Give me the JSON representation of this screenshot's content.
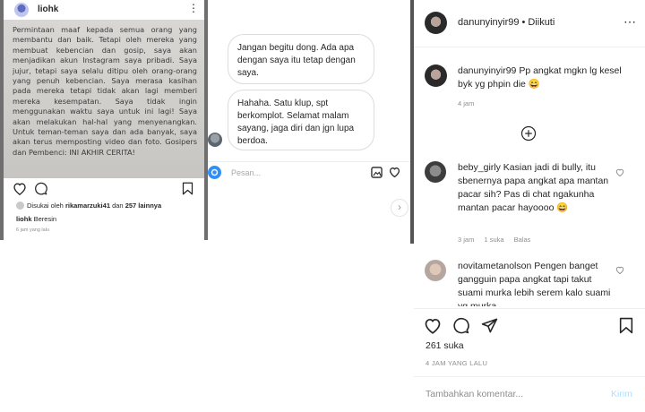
{
  "left_post": {
    "username": "liohk",
    "image_text": "Permintaan maaf kepada semua orang yang membantu dan baik. Tetapi oleh mereka yang membuat kebencian dan gosip, saya akan menjadikan akun Instagram saya pribadi. Saya jujur, tetapi saya selalu ditipu oleh orang-orang yang penuh kebencian. Saya merasa kasihan pada mereka tetapi tidak akan lagi memberi mereka kesempatan. Saya tidak ingin menggunakan waktu saya untuk ini lagi! Saya akan melakukan hal-hal yang menyenangkan. Untuk teman-teman saya dan ada banyak, saya akan terus memposting video dan foto. Gosipers dan Pembenci: INI AKHIR CERITA!",
    "liked_prefix": "Disukai oleh",
    "liked_user": "rikamarzuki41",
    "liked_mid": "dan",
    "liked_others": "257 lainnya",
    "caption_user": "liohk",
    "caption_text": "Beresin",
    "time": "6 jam yang lalu"
  },
  "chat": {
    "bubble_1": "Jangan begitu dong. Ada apa dengan saya itu tetap dengan saya.",
    "bubble_2": "Hahaha. Satu klup, spt berkomplot. Selamat malam sayang, jaga diri dan jgn lupa berdoa.",
    "composer_placeholder": "Pesan..."
  },
  "right_panel": {
    "header_username": "danunyinyir99",
    "header_dot": "•",
    "header_follow": "Diikuti",
    "caption_username": "danunyinyir99",
    "caption_text": "Pp angkat mgkn lg kesel byk yg phpin die 😄",
    "caption_time": "4 jam",
    "comments": [
      {
        "username": "beby_girly",
        "text": "Kasian jadi di bully, itu sbenernya papa angkat apa mantan pacar sih? Pas di chat ngakunha mantan pacar hayoooo 😄",
        "time": "3 jam",
        "likes": "1 suka",
        "reply": "Balas"
      },
      {
        "username": "novitametanolson",
        "text": "Pengen banget gangguin papa angkat tapi takut suami murka lebih serem kalo suami yg murka"
      }
    ],
    "likes_count": "261 suka",
    "post_time": "4 JAM YANG LALU",
    "comment_placeholder": "Tambahkan komentar...",
    "post_button": "Kirim"
  },
  "icons": {
    "heart": "heart-icon",
    "comment": "comment-icon",
    "share": "paper-plane-icon",
    "bookmark": "bookmark-icon",
    "more": "more-options-icon",
    "add": "plus-circle-icon"
  },
  "colors": {
    "link_blue_disabled": "#b2dffc",
    "muted_text": "#8e8e8e",
    "divider": "#555555"
  }
}
